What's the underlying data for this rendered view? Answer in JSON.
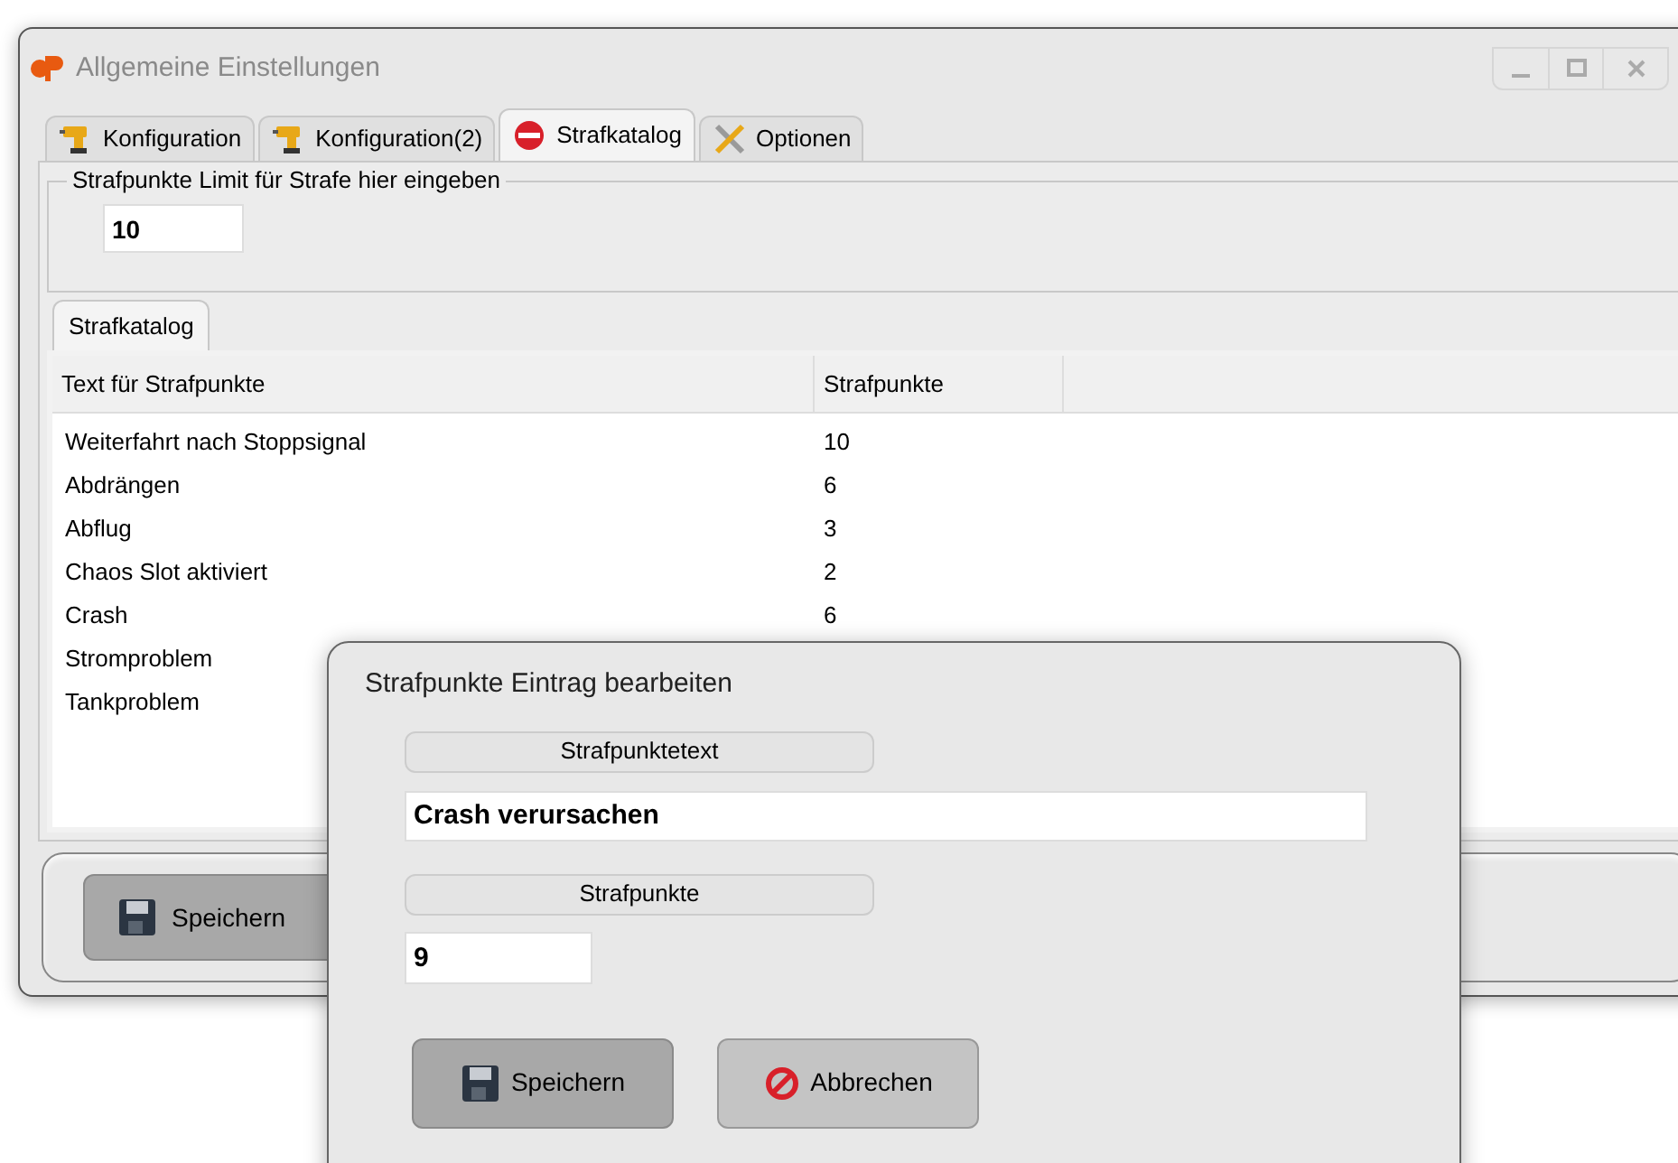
{
  "window": {
    "title": "Allgemeine Einstellungen"
  },
  "tabs": [
    {
      "label": "Konfiguration",
      "selected": false,
      "kind": "drill"
    },
    {
      "label": "Konfiguration(2)",
      "selected": false,
      "kind": "drill"
    },
    {
      "label": "Strafkatalog",
      "selected": true,
      "kind": "stop"
    },
    {
      "label": "Optionen",
      "selected": false,
      "kind": "tools"
    }
  ],
  "limit_group": {
    "legend": "Strafpunkte Limit für Strafe hier eingeben",
    "value": "10"
  },
  "inner_tab": {
    "label": "Strafkatalog",
    "selected": true
  },
  "table": {
    "columns": [
      "Text für Strafpunkte",
      "Strafpunkte"
    ],
    "rows": [
      {
        "text": "Weiterfahrt nach Stoppsignal",
        "points": "10"
      },
      {
        "text": "Abdrängen",
        "points": "6"
      },
      {
        "text": "Abflug",
        "points": "3"
      },
      {
        "text": "Chaos Slot aktiviert",
        "points": "2"
      },
      {
        "text": "Crash",
        "points": "6"
      },
      {
        "text": "Stromproblem"
      },
      {
        "text": "Tankproblem"
      }
    ]
  },
  "save_button": "Speichern",
  "dialog": {
    "title": "Strafpunkte Eintrag bearbeiten",
    "text_label": "Strafpunktetext",
    "text_value": "Crash verursachen",
    "points_label": "Strafpunkte",
    "points_value": "9",
    "save_button": "Speichern",
    "cancel_button": "Abbrechen"
  }
}
